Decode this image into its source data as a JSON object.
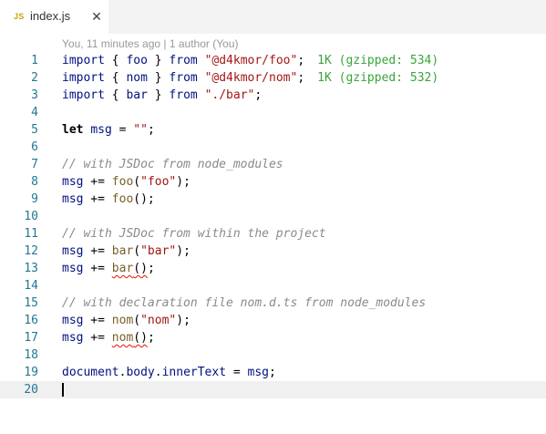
{
  "tab": {
    "icon_text": "JS",
    "label": "index.js",
    "close_glyph": "✕"
  },
  "codelens": "You, 11 minutes ago | 1 author (You)",
  "lines": [
    {
      "num": "1",
      "tokens": [
        {
          "t": "import",
          "c": "id"
        },
        {
          "t": " { ",
          "c": "op"
        },
        {
          "t": "foo",
          "c": "id"
        },
        {
          "t": " } ",
          "c": "op"
        },
        {
          "t": "from",
          "c": "id"
        },
        {
          "t": " ",
          "c": "op"
        },
        {
          "t": "\"@d4kmor/foo\"",
          "c": "str"
        },
        {
          "t": ";",
          "c": "op"
        }
      ],
      "hint": "1K (gzipped: 534)"
    },
    {
      "num": "2",
      "tokens": [
        {
          "t": "import",
          "c": "id"
        },
        {
          "t": " { ",
          "c": "op"
        },
        {
          "t": "nom",
          "c": "id"
        },
        {
          "t": " } ",
          "c": "op"
        },
        {
          "t": "from",
          "c": "id"
        },
        {
          "t": " ",
          "c": "op"
        },
        {
          "t": "\"@d4kmor/nom\"",
          "c": "str"
        },
        {
          "t": ";",
          "c": "op"
        }
      ],
      "hint": "1K (gzipped: 532)"
    },
    {
      "num": "3",
      "tokens": [
        {
          "t": "import",
          "c": "id"
        },
        {
          "t": " { ",
          "c": "op"
        },
        {
          "t": "bar",
          "c": "id"
        },
        {
          "t": " } ",
          "c": "op"
        },
        {
          "t": "from",
          "c": "id"
        },
        {
          "t": " ",
          "c": "op"
        },
        {
          "t": "\"./bar\"",
          "c": "str"
        },
        {
          "t": ";",
          "c": "op"
        }
      ]
    },
    {
      "num": "4",
      "tokens": []
    },
    {
      "num": "5",
      "tokens": [
        {
          "t": "let",
          "c": "kwb"
        },
        {
          "t": " ",
          "c": "op"
        },
        {
          "t": "msg",
          "c": "id"
        },
        {
          "t": " = ",
          "c": "op"
        },
        {
          "t": "\"\"",
          "c": "str"
        },
        {
          "t": ";",
          "c": "op"
        }
      ]
    },
    {
      "num": "6",
      "tokens": []
    },
    {
      "num": "7",
      "tokens": [
        {
          "t": "// with JSDoc from node_modules",
          "c": "cm"
        }
      ]
    },
    {
      "num": "8",
      "tokens": [
        {
          "t": "msg",
          "c": "id"
        },
        {
          "t": " += ",
          "c": "op"
        },
        {
          "t": "foo",
          "c": "fn"
        },
        {
          "t": "(",
          "c": "op"
        },
        {
          "t": "\"foo\"",
          "c": "str"
        },
        {
          "t": ");",
          "c": "op"
        }
      ]
    },
    {
      "num": "9",
      "tokens": [
        {
          "t": "msg",
          "c": "id"
        },
        {
          "t": " += ",
          "c": "op"
        },
        {
          "t": "foo",
          "c": "fn"
        },
        {
          "t": "();",
          "c": "op"
        }
      ]
    },
    {
      "num": "10",
      "tokens": []
    },
    {
      "num": "11",
      "tokens": [
        {
          "t": "// with JSDoc from within the project",
          "c": "cm"
        }
      ]
    },
    {
      "num": "12",
      "tokens": [
        {
          "t": "msg",
          "c": "id"
        },
        {
          "t": " += ",
          "c": "op"
        },
        {
          "t": "bar",
          "c": "fn"
        },
        {
          "t": "(",
          "c": "op"
        },
        {
          "t": "\"bar\"",
          "c": "str"
        },
        {
          "t": ");",
          "c": "op"
        }
      ]
    },
    {
      "num": "13",
      "tokens": [
        {
          "t": "msg",
          "c": "id"
        },
        {
          "t": " += ",
          "c": "op"
        },
        {
          "t": "bar",
          "c": "fn",
          "sq": true
        },
        {
          "t": "()",
          "c": "op",
          "sq": true
        },
        {
          "t": ";",
          "c": "op"
        }
      ]
    },
    {
      "num": "14",
      "tokens": []
    },
    {
      "num": "15",
      "tokens": [
        {
          "t": "// with declaration file nom.d.ts from node_modules",
          "c": "cm"
        }
      ]
    },
    {
      "num": "16",
      "tokens": [
        {
          "t": "msg",
          "c": "id"
        },
        {
          "t": " += ",
          "c": "op"
        },
        {
          "t": "nom",
          "c": "fn"
        },
        {
          "t": "(",
          "c": "op"
        },
        {
          "t": "\"nom\"",
          "c": "str"
        },
        {
          "t": ");",
          "c": "op"
        }
      ]
    },
    {
      "num": "17",
      "tokens": [
        {
          "t": "msg",
          "c": "id"
        },
        {
          "t": " += ",
          "c": "op"
        },
        {
          "t": "nom",
          "c": "fn",
          "sq": true
        },
        {
          "t": "()",
          "c": "op",
          "sq": true
        },
        {
          "t": ";",
          "c": "op"
        }
      ]
    },
    {
      "num": "18",
      "tokens": []
    },
    {
      "num": "19",
      "tokens": [
        {
          "t": "document",
          "c": "id"
        },
        {
          "t": ".",
          "c": "op"
        },
        {
          "t": "body",
          "c": "id"
        },
        {
          "t": ".",
          "c": "op"
        },
        {
          "t": "innerText",
          "c": "id"
        },
        {
          "t": " = ",
          "c": "op"
        },
        {
          "t": "msg",
          "c": "id"
        },
        {
          "t": ";",
          "c": "op"
        }
      ]
    },
    {
      "num": "20",
      "tokens": [],
      "current": true
    }
  ]
}
